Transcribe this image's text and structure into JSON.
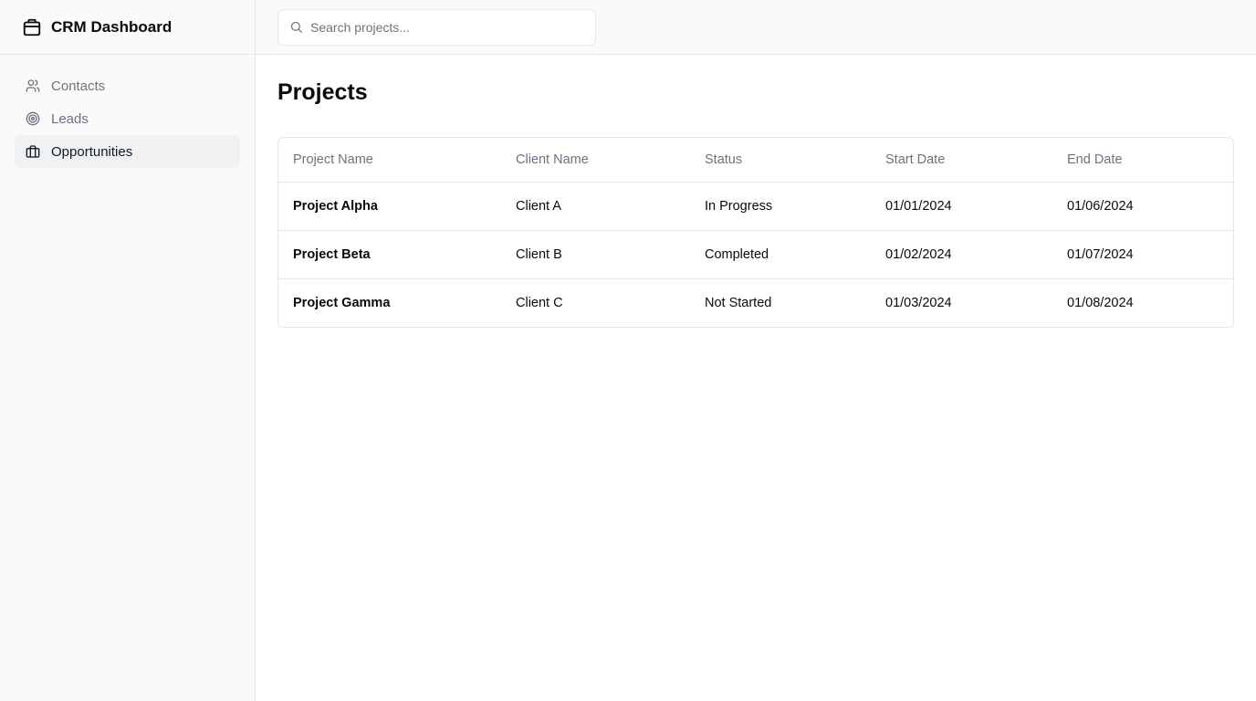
{
  "app": {
    "title": "CRM Dashboard",
    "logo_icon": "package-icon"
  },
  "sidebar": {
    "items": [
      {
        "label": "Contacts",
        "icon": "users-icon",
        "active": false
      },
      {
        "label": "Leads",
        "icon": "target-icon",
        "active": false
      },
      {
        "label": "Opportunities",
        "icon": "briefcase-icon",
        "active": true
      }
    ]
  },
  "search": {
    "placeholder": "Search projects...",
    "value": ""
  },
  "main": {
    "title": "Projects",
    "table": {
      "headers": [
        "Project Name",
        "Client Name",
        "Status",
        "Start Date",
        "End Date"
      ],
      "rows": [
        [
          "Project Alpha",
          "Client A",
          "In Progress",
          "01/01/2024",
          "01/06/2024"
        ],
        [
          "Project Beta",
          "Client B",
          "Completed",
          "01/02/2024",
          "01/07/2024"
        ],
        [
          "Project Gamma",
          "Client C",
          "Not Started",
          "01/03/2024",
          "01/08/2024"
        ]
      ]
    }
  },
  "colors": {
    "sidebar_bg": "#fafafa",
    "border": "#e5e7eb",
    "muted_text": "#6b7280",
    "active_bg": "#f0f1f3"
  }
}
